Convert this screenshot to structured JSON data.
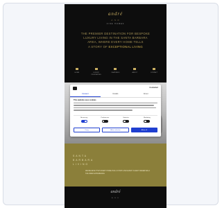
{
  "site": {
    "logo_main": "andré",
    "logo_sub": "A·N·D",
    "tagline": "FINE HOMES",
    "hero_line1": "THE PREMIER DESTINATION FOR BESPOKE",
    "hero_line2": "LUXURY LIVING IN THE SANTA BARBARA",
    "hero_line3": "AREA, WHERE EVERY HOME TELLS",
    "hero_line4a": "A STORY OF ",
    "hero_highlight": "EXCEPTIONAL LIVING",
    "nav": [
      {
        "label": "HOME"
      },
      {
        "label": "LUXURY PROPERTIES"
      },
      {
        "label": "FEATURED"
      },
      {
        "label": "ABOUT"
      },
      {
        "label": "CONTACT"
      }
    ]
  },
  "cookie_dialog": {
    "brand": "Cookiebot",
    "tabs": [
      "Consent",
      "Details",
      "About"
    ],
    "active_tab": 0,
    "title": "This website uses cookies",
    "categories": [
      {
        "label": "Necessary",
        "on": true
      },
      {
        "label": "Preferences",
        "on": false
      },
      {
        "label": "Statistics",
        "on": false
      },
      {
        "label": "Marketing",
        "on": false
      }
    ],
    "buttons": {
      "deny": "Deny",
      "selection": "Allow selection",
      "allow_all": "Allow all"
    }
  },
  "gold_section": {
    "heading1": "SANTA",
    "heading2": "BARBARA",
    "heading3": "LIVING",
    "body": "WE BELIEVE THAT EVERY HOME HAS A STORY AND EVERY CLIENT DESERVES A TAILORED EXPERIENCE"
  },
  "footer": {
    "logo": "andré",
    "sub": "A·N·D"
  },
  "colors": {
    "gold": "#c9ae62",
    "gold_band": "#8b7f3a",
    "primary_blue": "#1f3fd0",
    "dark": "#0d0d0d"
  }
}
